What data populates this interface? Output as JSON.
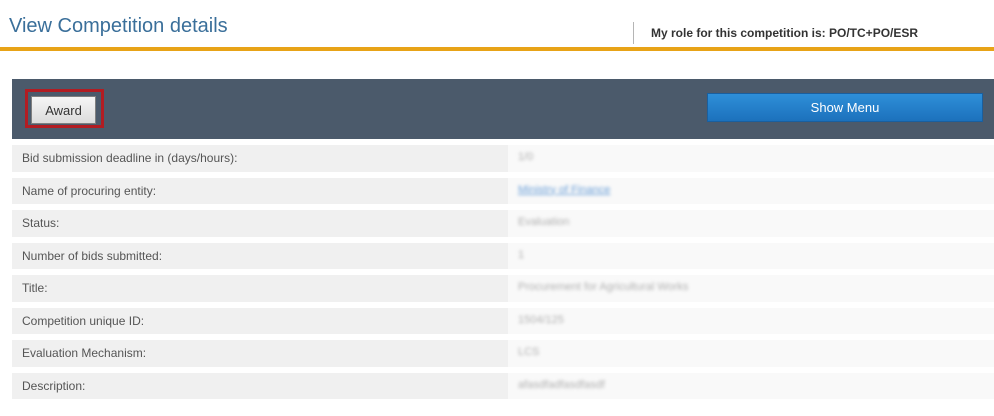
{
  "header": {
    "title": "View Competition details",
    "role_text": "My role for this competition is: PO/TC+PO/ESR"
  },
  "toolbar": {
    "award_label": "Award",
    "show_menu_label": "Show Menu"
  },
  "details": [
    {
      "label": "Bid submission deadline in (days/hours):",
      "value": "1/0",
      "is_link": false
    },
    {
      "label": "Name of procuring entity:",
      "value": "Ministry of Finance",
      "is_link": true
    },
    {
      "label": "Status:",
      "value": "Evaluation",
      "is_link": false
    },
    {
      "label": "Number of bids submitted:",
      "value": "1",
      "is_link": false
    },
    {
      "label": "Title:",
      "value": "Procurement for Agricultural Works",
      "is_link": false
    },
    {
      "label": "Competition unique ID:",
      "value": "1504/125",
      "is_link": false
    },
    {
      "label": "Evaluation Mechanism:",
      "value": "LCS",
      "is_link": false
    },
    {
      "label": "Description:",
      "value": "afasdfadfasdfasdf",
      "is_link": false
    }
  ],
  "colors": {
    "title": "#3a6f9a",
    "accent_rule": "#e8a317",
    "toolbar_bg": "#4b5a6b",
    "award_highlight": "#b21c22",
    "show_menu_bg": "#1f7ac6"
  }
}
